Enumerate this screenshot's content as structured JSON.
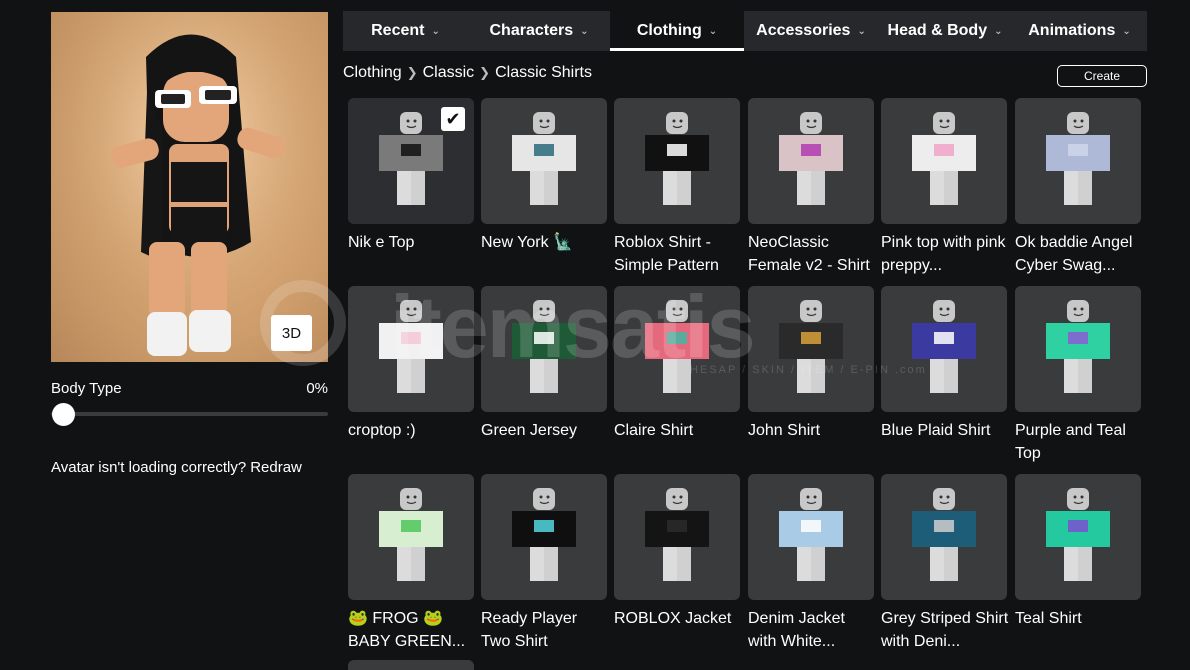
{
  "avatar": {
    "view_toggle_label": "3D",
    "body_type_label": "Body Type",
    "body_type_value": "0%",
    "reload_text": "Avatar isn't loading correctly?",
    "reload_link": "Redraw"
  },
  "tabs": [
    {
      "label": "Recent",
      "active": false
    },
    {
      "label": "Characters",
      "active": false
    },
    {
      "label": "Clothing",
      "active": true
    },
    {
      "label": "Accessories",
      "active": false
    },
    {
      "label": "Head & Body",
      "active": false
    },
    {
      "label": "Animations",
      "active": false
    }
  ],
  "breadcrumb": [
    "Clothing",
    "Classic",
    "Classic Shirts"
  ],
  "create_label": "Create",
  "items": [
    {
      "name": "Nik e Top",
      "selected": true,
      "color": "#7a7a7a",
      "accent": "#111111"
    },
    {
      "name": "New York 🗽",
      "selected": false,
      "color": "#e6e6e6",
      "accent": "#2a6a7a"
    },
    {
      "name": "Roblox Shirt - Simple Pattern",
      "selected": false,
      "color": "#111111",
      "accent": "#ffffff"
    },
    {
      "name": "NeoClassic Female v2 - Shirt",
      "selected": false,
      "color": "#d9c3c7",
      "accent": "#b13bb0"
    },
    {
      "name": "Pink top with pink preppy...",
      "selected": false,
      "color": "#ededed",
      "accent": "#f2a3c7"
    },
    {
      "name": "Ok baddie Angel Cyber Swag...",
      "selected": false,
      "color": "#aeb9d8",
      "accent": "#cfd6ea"
    },
    {
      "name": "croptop :)",
      "selected": false,
      "color": "#f1f1f1",
      "accent": "#f4c6d6"
    },
    {
      "name": "Green Jersey",
      "selected": false,
      "color": "#1f5a36",
      "accent": "#ffffff"
    },
    {
      "name": "Claire Shirt",
      "selected": false,
      "color": "#e5697c",
      "accent": "#3fb7a3"
    },
    {
      "name": "John Shirt",
      "selected": false,
      "color": "#2a2a2a",
      "accent": "#d9a13a"
    },
    {
      "name": "Blue Plaid Shirt",
      "selected": false,
      "color": "#3a3aa0",
      "accent": "#ffffff"
    },
    {
      "name": "Purple and Teal Top",
      "selected": false,
      "color": "#2fd1a3",
      "accent": "#8c5bd6"
    },
    {
      "name": "🐸 FROG 🐸 BABY GREEN...",
      "selected": false,
      "color": "#d7efd0",
      "accent": "#4fc65b"
    },
    {
      "name": "Ready Player Two Shirt",
      "selected": false,
      "color": "#0f0f0f",
      "accent": "#52d6e0"
    },
    {
      "name": "ROBLOX Jacket",
      "selected": false,
      "color": "#141414",
      "accent": "#2a2a2a"
    },
    {
      "name": "Denim Jacket with White...",
      "selected": false,
      "color": "#a9cbe6",
      "accent": "#ffffff"
    },
    {
      "name": "Grey Striped Shirt with Deni...",
      "selected": false,
      "color": "#1e5d77",
      "accent": "#cfcfcf"
    },
    {
      "name": "Teal Shirt",
      "selected": false,
      "color": "#24c9a0",
      "accent": "#7b4fd1"
    }
  ],
  "watermark": {
    "text": "itemsatis",
    "subtext": "HESAP / SKIN / ITEM / E-PIN .com"
  }
}
